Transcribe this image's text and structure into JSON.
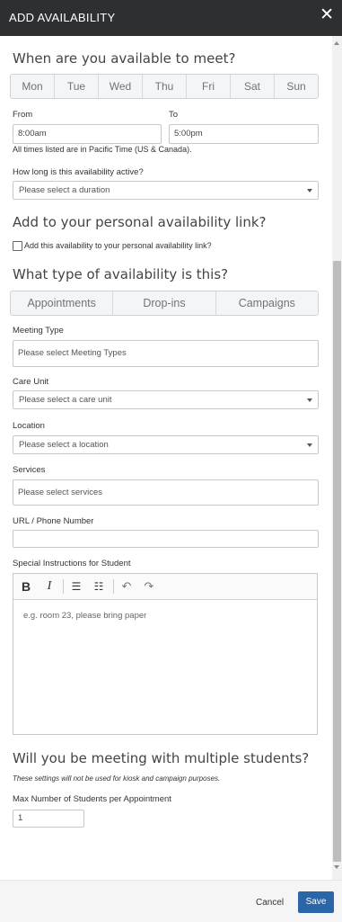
{
  "header": {
    "title": "ADD AVAILABILITY",
    "close_glyph": "✕"
  },
  "when": {
    "heading": "When are you available to meet?",
    "days": [
      "Mon",
      "Tue",
      "Wed",
      "Thu",
      "Fri",
      "Sat",
      "Sun"
    ],
    "from_label": "From",
    "from_value": "8:00am",
    "to_label": "To",
    "to_value": "5:00pm",
    "timezone_note": "All times listed are in Pacific Time (US & Canada).",
    "duration_label": "How long is this availability active?",
    "duration_placeholder": "Please select a duration"
  },
  "personal_link": {
    "heading": "Add to your personal availability link?",
    "checkbox_label": "Add this availability to your personal availability link?"
  },
  "type": {
    "heading": "What type of availability is this?",
    "options": [
      "Appointments",
      "Drop-ins",
      "Campaigns"
    ]
  },
  "fields": {
    "meeting_type_label": "Meeting Type",
    "meeting_type_placeholder": "Please select Meeting Types",
    "care_unit_label": "Care Unit",
    "care_unit_placeholder": "Please select a care unit",
    "location_label": "Location",
    "location_placeholder": "Please select a location",
    "services_label": "Services",
    "services_placeholder": "Please select services",
    "url_label": "URL / Phone Number",
    "url_value": "",
    "instructions_label": "Special Instructions for Student",
    "instructions_placeholder": "e.g. room 23, please bring paper"
  },
  "editor_toolbar": {
    "bold": "B",
    "italic": "I",
    "bullets": "☰",
    "numbered": "☷",
    "undo": "↶",
    "redo": "↷"
  },
  "multiple": {
    "heading": "Will you be meeting with multiple students?",
    "note": "These settings will not be used for kiosk and campaign purposes.",
    "max_label": "Max Number of Students per Appointment",
    "max_value": "1"
  },
  "footer": {
    "cancel": "Cancel",
    "save": "Save"
  }
}
